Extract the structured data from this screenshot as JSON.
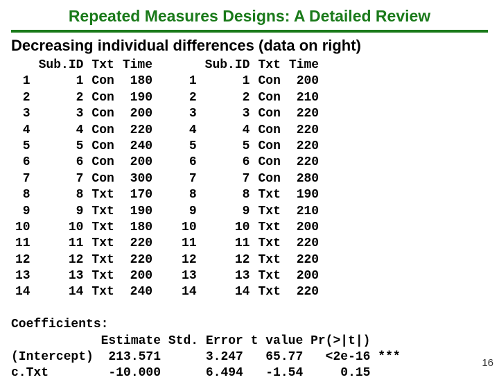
{
  "title": "Repeated Measures Designs: A Detailed Review",
  "subtitle_main": "Decreasing individual differences",
  "subtitle_paren": "(data on right)",
  "headers": {
    "idx": "",
    "subid": "Sub.ID",
    "txt": "Txt",
    "time": "Time"
  },
  "left": [
    {
      "i": "1",
      "s": "1",
      "t": "Con",
      "v": "180"
    },
    {
      "i": "2",
      "s": "2",
      "t": "Con",
      "v": "190"
    },
    {
      "i": "3",
      "s": "3",
      "t": "Con",
      "v": "200"
    },
    {
      "i": "4",
      "s": "4",
      "t": "Con",
      "v": "220"
    },
    {
      "i": "5",
      "s": "5",
      "t": "Con",
      "v": "240"
    },
    {
      "i": "6",
      "s": "6",
      "t": "Con",
      "v": "200"
    },
    {
      "i": "7",
      "s": "7",
      "t": "Con",
      "v": "300"
    },
    {
      "i": "8",
      "s": "8",
      "t": "Txt",
      "v": "170"
    },
    {
      "i": "9",
      "s": "9",
      "t": "Txt",
      "v": "190"
    },
    {
      "i": "10",
      "s": "10",
      "t": "Txt",
      "v": "180"
    },
    {
      "i": "11",
      "s": "11",
      "t": "Txt",
      "v": "220"
    },
    {
      "i": "12",
      "s": "12",
      "t": "Txt",
      "v": "220"
    },
    {
      "i": "13",
      "s": "13",
      "t": "Txt",
      "v": "200"
    },
    {
      "i": "14",
      "s": "14",
      "t": "Txt",
      "v": "240"
    }
  ],
  "right": [
    {
      "i": "1",
      "s": "1",
      "t": "Con",
      "v": "200"
    },
    {
      "i": "2",
      "s": "2",
      "t": "Con",
      "v": "210"
    },
    {
      "i": "3",
      "s": "3",
      "t": "Con",
      "v": "220"
    },
    {
      "i": "4",
      "s": "4",
      "t": "Con",
      "v": "220"
    },
    {
      "i": "5",
      "s": "5",
      "t": "Con",
      "v": "220"
    },
    {
      "i": "6",
      "s": "6",
      "t": "Con",
      "v": "220"
    },
    {
      "i": "7",
      "s": "7",
      "t": "Con",
      "v": "280"
    },
    {
      "i": "8",
      "s": "8",
      "t": "Txt",
      "v": "190"
    },
    {
      "i": "9",
      "s": "9",
      "t": "Txt",
      "v": "210"
    },
    {
      "i": "10",
      "s": "10",
      "t": "Txt",
      "v": "200"
    },
    {
      "i": "11",
      "s": "11",
      "t": "Txt",
      "v": "220"
    },
    {
      "i": "12",
      "s": "12",
      "t": "Txt",
      "v": "220"
    },
    {
      "i": "13",
      "s": "13",
      "t": "Txt",
      "v": "200"
    },
    {
      "i": "14",
      "s": "14",
      "t": "Txt",
      "v": "220"
    }
  ],
  "coeff": {
    "title": "Coefficients:",
    "hdr": "            Estimate Std. Error t value Pr(>|t|)",
    "row1": "(Intercept)  213.571      3.247   65.77   <2e-16 ***",
    "row2": "c.Txt        -10.000      6.494   -1.54     0.15"
  },
  "pagenum": "16"
}
